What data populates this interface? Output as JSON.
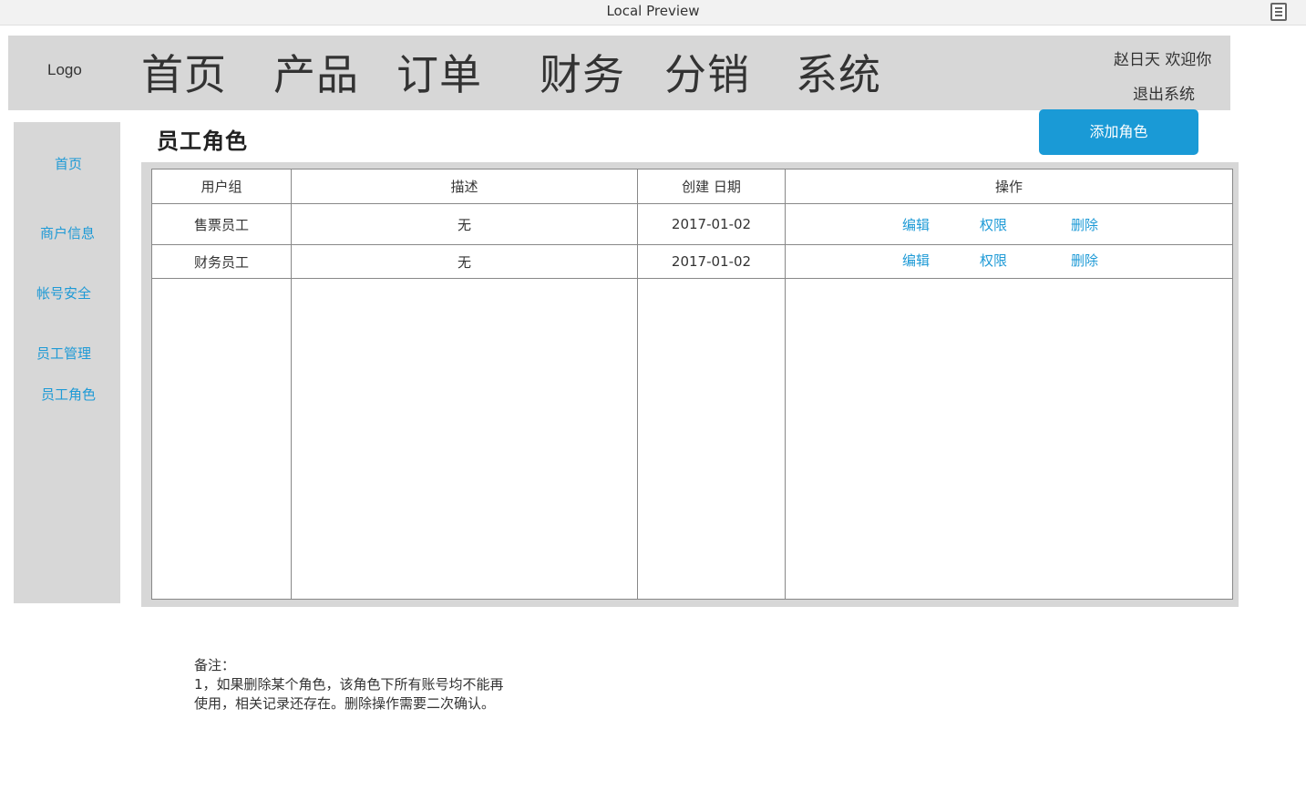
{
  "window": {
    "title": "Local Preview",
    "menu_icon": "document-lines-icon"
  },
  "header": {
    "logo": "Logo",
    "nav": [
      "首页",
      "产品",
      "订单",
      "财务",
      "分销",
      "系统"
    ],
    "user_greeting": "赵日天 欢迎你",
    "logout": "退出系统"
  },
  "sidebar": {
    "items": [
      "首页",
      "商户信息",
      "帐号安全",
      "员工管理",
      "员工角色"
    ]
  },
  "main": {
    "title": "员工角色",
    "add_button": "添加角色",
    "table": {
      "columns": [
        "用户组",
        "描述",
        "创建 日期",
        "操作"
      ],
      "rows": [
        {
          "group": "售票员工",
          "desc": "无",
          "date": "2017-01-02",
          "actions": [
            "编辑",
            "权限",
            "删除"
          ]
        },
        {
          "group": "财务员工",
          "desc": "无",
          "date": "2017-01-02",
          "actions": [
            "编辑",
            "权限",
            "删除"
          ]
        }
      ]
    }
  },
  "notes": {
    "heading": "备注：",
    "lines": [
      "1，如果删除某个角色，该角色下所有账号均不能再",
      "使用，相关记录还存在。删除操作需要二次确认。"
    ]
  },
  "colors": {
    "accent": "#1a9ad6",
    "link": "#1e9ad6",
    "panel_gray": "#d7d7d7"
  }
}
